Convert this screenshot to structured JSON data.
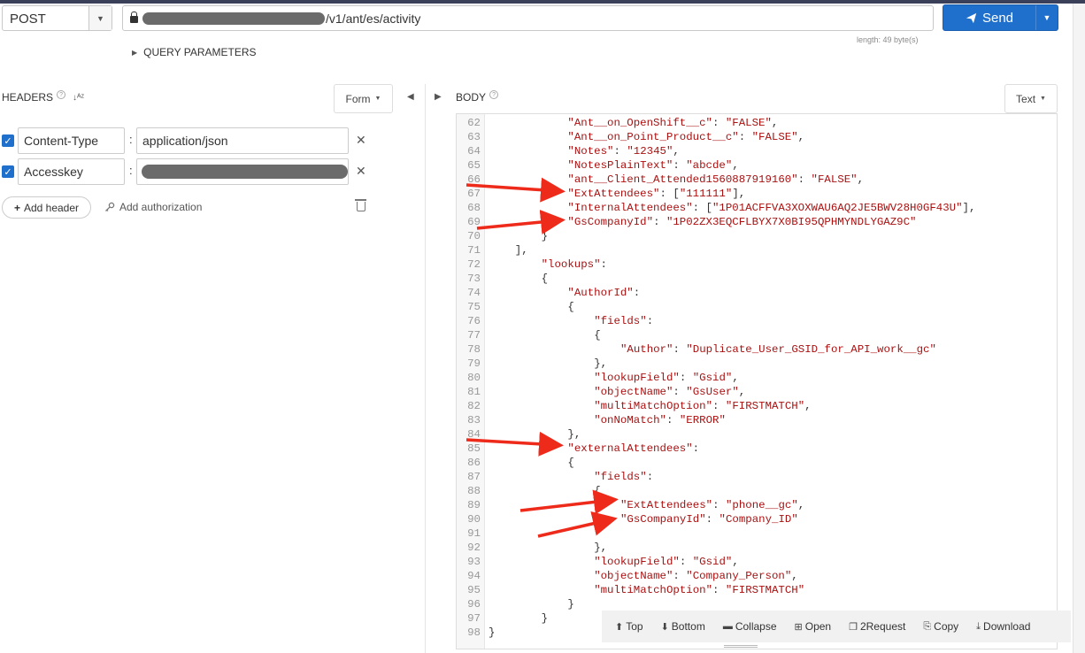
{
  "request": {
    "method": "POST",
    "url_suffix": "/v1/ant/es/activity",
    "length_text": "length: 49 byte(s)",
    "send_label": "Send",
    "query_params_label": "QUERY PARAMETERS"
  },
  "headers_panel": {
    "title": "HEADERS",
    "form_label": "Form",
    "rows": [
      {
        "key": "Content-Type",
        "value": "application/json",
        "enabled": true
      },
      {
        "key": "Accesskey",
        "value": "",
        "enabled": true
      }
    ],
    "add_header_label": "Add header",
    "add_auth_label": "Add authorization"
  },
  "body_panel": {
    "title": "BODY",
    "text_label": "Text",
    "lines": [
      {
        "n": "62",
        "indent": 12,
        "parts": [
          [
            "s",
            "\"Ant__on_OpenShift__c\""
          ],
          [
            "p",
            ": "
          ],
          [
            "s",
            "\"FALSE\""
          ],
          [
            "p",
            ","
          ]
        ]
      },
      {
        "n": "63",
        "indent": 12,
        "parts": [
          [
            "s",
            "\"Ant__on_Point_Product__c\""
          ],
          [
            "p",
            ": "
          ],
          [
            "s",
            "\"FALSE\""
          ],
          [
            "p",
            ","
          ]
        ]
      },
      {
        "n": "64",
        "indent": 12,
        "parts": [
          [
            "s",
            "\"Notes\""
          ],
          [
            "p",
            ": "
          ],
          [
            "s",
            "\"12345\""
          ],
          [
            "p",
            ","
          ]
        ]
      },
      {
        "n": "65",
        "indent": 12,
        "parts": [
          [
            "s",
            "\"NotesPlainText\""
          ],
          [
            "p",
            ": "
          ],
          [
            "s",
            "\"abcde\""
          ],
          [
            "p",
            ","
          ]
        ]
      },
      {
        "n": "66",
        "indent": 12,
        "parts": [
          [
            "s",
            "\"ant__Client_Attended1560887919160\""
          ],
          [
            "p",
            ": "
          ],
          [
            "s",
            "\"FALSE\""
          ],
          [
            "p",
            ","
          ]
        ]
      },
      {
        "n": "67",
        "indent": 12,
        "parts": [
          [
            "s",
            "\"ExtAttendees\""
          ],
          [
            "p",
            ": ["
          ],
          [
            "s",
            "\"111111\""
          ],
          [
            "p",
            "],"
          ]
        ]
      },
      {
        "n": "68",
        "indent": 12,
        "parts": [
          [
            "s",
            "\"InternalAttendees\""
          ],
          [
            "p",
            ": ["
          ],
          [
            "s",
            "\"1P01ACFFVA3XOXWAU6AQ2JE5BWV28H0GF43U\""
          ],
          [
            "p",
            "],"
          ]
        ]
      },
      {
        "n": "69",
        "indent": 12,
        "parts": [
          [
            "s",
            "\"GsCompanyId\""
          ],
          [
            "p",
            ": "
          ],
          [
            "s",
            "\"1P02ZX3EQCFLBYX7X0BI95QPHMYNDLYGAZ9C\""
          ]
        ]
      },
      {
        "n": "70",
        "indent": 8,
        "parts": [
          [
            "p",
            "}"
          ]
        ]
      },
      {
        "n": "71",
        "indent": 4,
        "parts": [
          [
            "p",
            "],"
          ]
        ]
      },
      {
        "n": "72",
        "indent": 8,
        "parts": [
          [
            "s",
            "\"lookups\""
          ],
          [
            "p",
            ":"
          ]
        ]
      },
      {
        "n": "73",
        "indent": 8,
        "parts": [
          [
            "p",
            "{"
          ]
        ]
      },
      {
        "n": "74",
        "indent": 12,
        "parts": [
          [
            "s",
            "\"AuthorId\""
          ],
          [
            "p",
            ":"
          ]
        ]
      },
      {
        "n": "75",
        "indent": 12,
        "parts": [
          [
            "p",
            "{"
          ]
        ]
      },
      {
        "n": "76",
        "indent": 16,
        "parts": [
          [
            "s",
            "\"fields\""
          ],
          [
            "p",
            ":"
          ]
        ]
      },
      {
        "n": "77",
        "indent": 16,
        "parts": [
          [
            "p",
            "{"
          ]
        ]
      },
      {
        "n": "78",
        "indent": 20,
        "parts": [
          [
            "s",
            "\"Author\""
          ],
          [
            "p",
            ": "
          ],
          [
            "s",
            "\"Duplicate_User_GSID_for_API_work__gc\""
          ]
        ]
      },
      {
        "n": "79",
        "indent": 16,
        "parts": [
          [
            "p",
            "},"
          ]
        ]
      },
      {
        "n": "80",
        "indent": 16,
        "parts": [
          [
            "s",
            "\"lookupField\""
          ],
          [
            "p",
            ": "
          ],
          [
            "s",
            "\"Gsid\""
          ],
          [
            "p",
            ","
          ]
        ]
      },
      {
        "n": "81",
        "indent": 16,
        "parts": [
          [
            "s",
            "\"objectName\""
          ],
          [
            "p",
            ": "
          ],
          [
            "s",
            "\"GsUser\""
          ],
          [
            "p",
            ","
          ]
        ]
      },
      {
        "n": "82",
        "indent": 16,
        "parts": [
          [
            "s",
            "\"multiMatchOption\""
          ],
          [
            "p",
            ": "
          ],
          [
            "s",
            "\"FIRSTMATCH\""
          ],
          [
            "p",
            ","
          ]
        ]
      },
      {
        "n": "83",
        "indent": 16,
        "parts": [
          [
            "s",
            "\"onNoMatch\""
          ],
          [
            "p",
            ": "
          ],
          [
            "s",
            "\"ERROR\""
          ]
        ]
      },
      {
        "n": "84",
        "indent": 12,
        "parts": [
          [
            "p",
            "},"
          ]
        ]
      },
      {
        "n": "85",
        "indent": 12,
        "parts": [
          [
            "s",
            "\"externalAttendees\""
          ],
          [
            "p",
            ":"
          ]
        ]
      },
      {
        "n": "86",
        "indent": 12,
        "parts": [
          [
            "p",
            "{"
          ]
        ]
      },
      {
        "n": "87",
        "indent": 16,
        "parts": [
          [
            "s",
            "\"fields\""
          ],
          [
            "p",
            ":"
          ]
        ]
      },
      {
        "n": "88",
        "indent": 16,
        "parts": [
          [
            "p",
            "{"
          ]
        ]
      },
      {
        "n": "89",
        "indent": 20,
        "parts": [
          [
            "s",
            "\"ExtAttendees\""
          ],
          [
            "p",
            ": "
          ],
          [
            "s",
            "\"phone__gc\""
          ],
          [
            "p",
            ","
          ]
        ]
      },
      {
        "n": "90",
        "indent": 20,
        "parts": [
          [
            "s",
            "\"GsCompanyId\""
          ],
          [
            "p",
            ": "
          ],
          [
            "s",
            "\"Company_ID\""
          ]
        ]
      },
      {
        "n": "91",
        "indent": 0,
        "parts": []
      },
      {
        "n": "92",
        "indent": 16,
        "parts": [
          [
            "p",
            "},"
          ]
        ]
      },
      {
        "n": "93",
        "indent": 16,
        "parts": [
          [
            "s",
            "\"lookupField\""
          ],
          [
            "p",
            ": "
          ],
          [
            "s",
            "\"Gsid\""
          ],
          [
            "p",
            ","
          ]
        ]
      },
      {
        "n": "94",
        "indent": 16,
        "parts": [
          [
            "s",
            "\"objectName\""
          ],
          [
            "p",
            ": "
          ],
          [
            "s",
            "\"Company_Person\""
          ],
          [
            "p",
            ","
          ]
        ]
      },
      {
        "n": "95",
        "indent": 16,
        "parts": [
          [
            "s",
            "\"multiMatchOption\""
          ],
          [
            "p",
            ": "
          ],
          [
            "s",
            "\"FIRSTMATCH\""
          ]
        ]
      },
      {
        "n": "96",
        "indent": 12,
        "parts": [
          [
            "p",
            "}"
          ]
        ]
      },
      {
        "n": "97",
        "indent": 8,
        "parts": [
          [
            "p",
            "}"
          ]
        ]
      },
      {
        "n": "98",
        "indent": 0,
        "parts": [
          [
            "p",
            "}"
          ]
        ]
      }
    ]
  },
  "toolbar": {
    "top": "Top",
    "bottom": "Bottom",
    "collapse": "Collapse",
    "open": "Open",
    "to_request": "2Request",
    "copy": "Copy",
    "download": "Download"
  },
  "colors": {
    "accent": "#1f6fcc",
    "string": "#aa1111",
    "annotation_arrow": "#ee2a1b"
  }
}
